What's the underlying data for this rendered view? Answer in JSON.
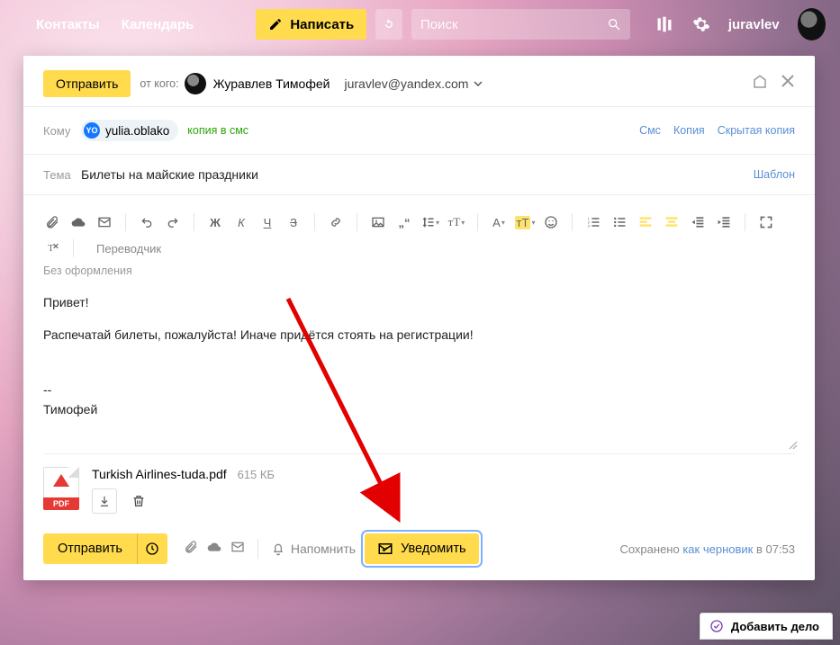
{
  "nav": {
    "contacts": "Контакты",
    "calendar": "Календарь",
    "compose": "Написать",
    "search_placeholder": "Поиск",
    "username": "juravlev"
  },
  "compose": {
    "send_top": "Отправить",
    "from_label": "от кого:",
    "from_name": "Журавлев Тимофей",
    "from_email": "juravlev@yandex.com",
    "to_label": "Кому",
    "to_chip_badge": "YO",
    "to_chip": "yulia.oblako",
    "sms_copy": "копия в смс",
    "link_sms": "Смс",
    "link_cc": "Копия",
    "link_bcc": "Скрытая копия",
    "subject_label": "Тема",
    "subject_value": "Билеты на майские праздники",
    "template": "Шаблон",
    "no_formatting": "Без оформления",
    "translator": "Переводчик"
  },
  "body": {
    "line1": "Привет!",
    "line2": "Распечатай билеты, пожалуйста! Иначе придётся стоять на регистрации!",
    "sig1": "--",
    "sig2": "Тимофей"
  },
  "attachment": {
    "badge": "PDF",
    "name": "Turkish Airlines-tuda.pdf",
    "size": "615 КБ"
  },
  "footer": {
    "send": "Отправить",
    "remind": "Напомнить",
    "notify": "Уведомить",
    "saved_prefix": "Сохранено ",
    "saved_link": "как черновик",
    "saved_time": " в 07:53"
  },
  "addtask": "Добавить дело"
}
